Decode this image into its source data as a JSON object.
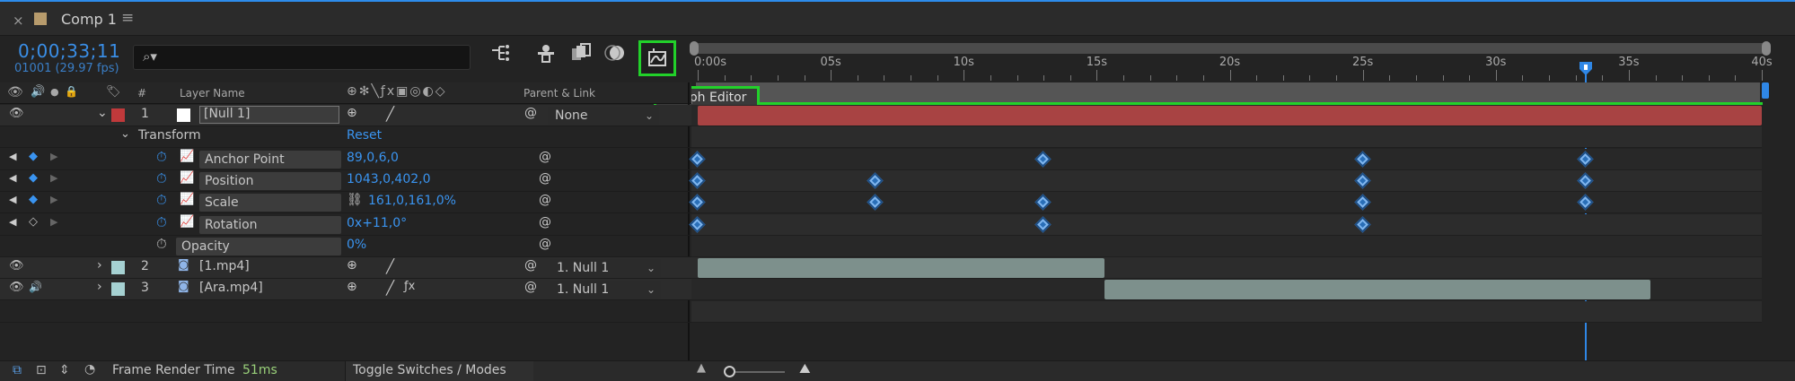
{
  "tab": {
    "title": "Comp 1",
    "close_glyph": "×",
    "menu_glyph": "≡"
  },
  "header": {
    "timecode": "0;00;33;11",
    "fps": "01001 (29.97 fps)",
    "search_placeholder": ""
  },
  "graph_editor": {
    "tooltip": "Graph Editor"
  },
  "ruler": {
    "labels": [
      "0:00s",
      "05s",
      "10s",
      "15s",
      "20s",
      "25s",
      "30s",
      "35s",
      "40s"
    ],
    "playhead_time_s": 33.4,
    "duration_s": 40
  },
  "columns": {
    "hash": "#",
    "layer_name": "Layer Name",
    "parent": "Parent & Link"
  },
  "layers": [
    {
      "num": "1",
      "name": "[Null 1]",
      "parent": "None",
      "label_color": "#c0393b",
      "bar_color": "#a84343",
      "bar_start_s": 0,
      "bar_end_s": 40
    },
    {
      "num": "2",
      "name": "[1.mp4]",
      "parent": "1. Null 1",
      "label_color": "#a6d1d2",
      "bar_color": "#7d908c",
      "bar_start_s": 0,
      "bar_end_s": 15.3
    },
    {
      "num": "3",
      "name": "[Ara.mp4]",
      "parent": "1. Null 1",
      "label_color": "#a6d1d2",
      "bar_color": "#7d908c",
      "bar_start_s": 15.3,
      "bar_end_s": 35.8
    }
  ],
  "transform": {
    "label": "Transform",
    "reset": "Reset"
  },
  "properties": [
    {
      "name": "Anchor Point",
      "value": "89,0,6,0",
      "keys_s": [
        0,
        13,
        25,
        33.4
      ]
    },
    {
      "name": "Position",
      "value": "1043,0,402,0",
      "keys_s": [
        0,
        6.7,
        25,
        33.4
      ]
    },
    {
      "name": "Scale",
      "value": "161,0,161,0%",
      "keys_s": [
        0,
        6.7,
        13,
        25,
        33.4
      ]
    },
    {
      "name": "Rotation",
      "value": "0x+11,0°",
      "keys_s": [
        0,
        13,
        25
      ]
    },
    {
      "name": "Opacity",
      "value": "0%",
      "keys_s": []
    }
  ],
  "bottom": {
    "frame_render_label": "Frame Render Time",
    "frame_render_value": "51ms",
    "toggle": "Toggle Switches / Modes"
  },
  "colors": {
    "accent": "#2f87e6",
    "highlight": "#22d12a"
  }
}
